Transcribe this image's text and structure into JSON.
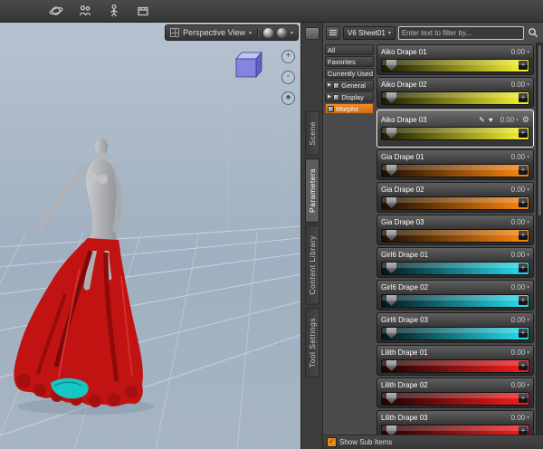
{
  "toolbar": {
    "icon_names": [
      "rotate-tool-icon",
      "people-tool-icon",
      "figure-tool-icon",
      "frame-tool-icon"
    ]
  },
  "viewport": {
    "view_selector": "Perspective View"
  },
  "side_tabs": [
    {
      "label": "Scene"
    },
    {
      "label": "Parameters",
      "active": true
    },
    {
      "label": "Content Library"
    },
    {
      "label": "Tool Settings"
    }
  ],
  "panel": {
    "scene_selector": "V6 Sheet01",
    "filter_placeholder": "Enter text to filter by...",
    "categories": [
      {
        "label": "All"
      },
      {
        "label": "Favorites"
      },
      {
        "label": "Currently Used"
      },
      {
        "label": "General",
        "expandable": true,
        "has_icon": true
      },
      {
        "label": "Display",
        "expandable": true,
        "has_icon": true
      },
      {
        "label": "Morphs",
        "selected": true,
        "has_icon": true
      }
    ],
    "sliders": [
      {
        "label": "Aiko Drape 01",
        "value": "0.00",
        "color": "#f0ec2c",
        "color2": "#191903"
      },
      {
        "label": "Aiko Drape 02",
        "value": "0.00",
        "color": "#f0ec2c",
        "color2": "#191903"
      },
      {
        "label": "Aiko Drape 03",
        "value": "0.00",
        "color": "#f0ec2c",
        "color2": "#191903",
        "selected": true
      },
      {
        "label": "Gia Drape 01",
        "value": "0.00",
        "color": "#f5820e",
        "color2": "#1a0d02"
      },
      {
        "label": "Gia Drape 02",
        "value": "0.00",
        "color": "#f5820e",
        "color2": "#1a0d02"
      },
      {
        "label": "Gia Drape 03",
        "value": "0.00",
        "color": "#f5820e",
        "color2": "#1a0d02"
      },
      {
        "label": "Girl6 Drape 01",
        "value": "0.00",
        "color": "#26d7e8",
        "color2": "#03161a"
      },
      {
        "label": "Girl6 Drape 02",
        "value": "0.00",
        "color": "#26d7e8",
        "color2": "#03161a"
      },
      {
        "label": "Girl6 Drape 03",
        "value": "0.00",
        "color": "#26d7e8",
        "color2": "#03161a"
      },
      {
        "label": "Lilith Drape 01",
        "value": "0.00",
        "color": "#ee1c1c",
        "color2": "#1a0303"
      },
      {
        "label": "Lilith Drape 02",
        "value": "0.00",
        "color": "#ee1c1c",
        "color2": "#1a0303"
      },
      {
        "label": "Lilith Drape 03",
        "value": "0.00",
        "color": "#ee1c1c",
        "color2": "#1a0303"
      }
    ],
    "show_sub_items_label": "Show Sub Items"
  },
  "icons": {
    "caret_down": "▾",
    "expand": "▶",
    "edit": "✎",
    "favorite": "♥",
    "gear": "⚙",
    "plus": "+",
    "check": "✓"
  },
  "colors": {
    "accent_orange": "#e8821e",
    "viewport_bg": "#a8b6c5",
    "dress_red": "#c21313",
    "dress_teal": "#17c5c5",
    "slider_yellow": "#f0ec2c",
    "slider_orange": "#f5820e",
    "slider_cyan": "#26d7e8",
    "slider_red": "#ee1c1c"
  }
}
